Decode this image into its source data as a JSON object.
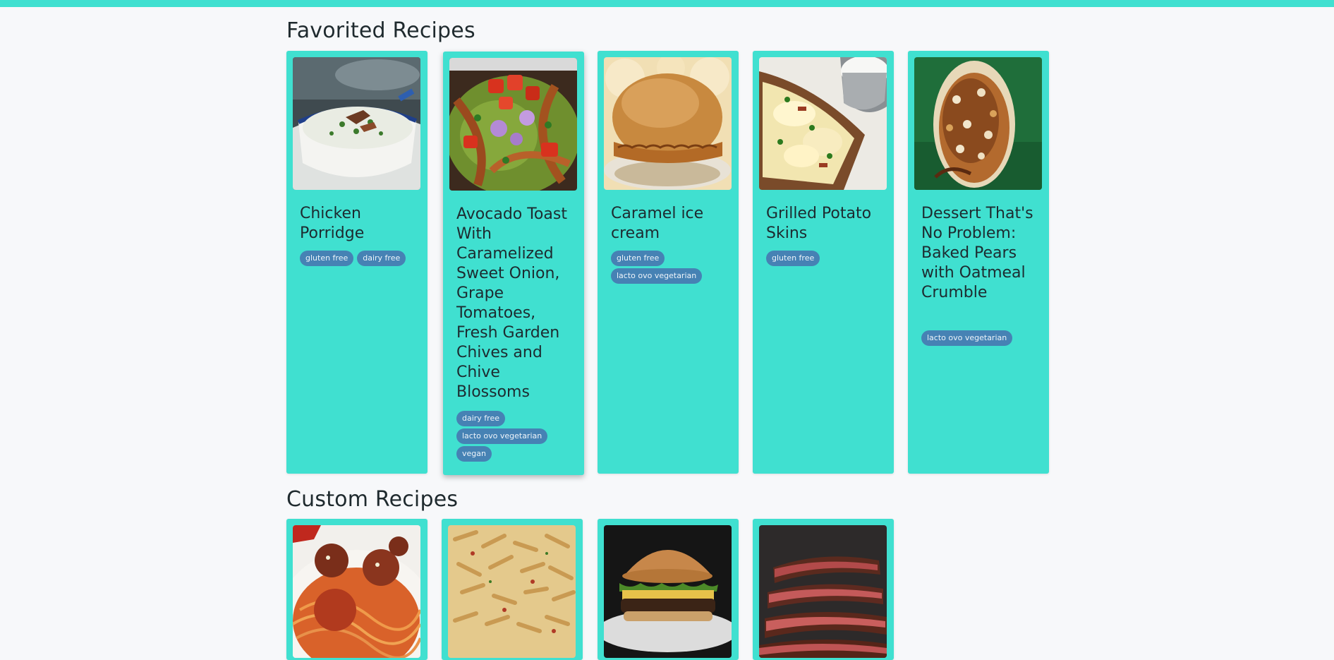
{
  "page": {
    "favorites_heading": "Favorited Recipes",
    "custom_heading": "Custom Recipes"
  },
  "colors": {
    "topbar": "#40e0d0",
    "card": "#40e0d0",
    "tag": "#4682b4",
    "background": "#f7f8fa"
  },
  "favorites": [
    {
      "title": "Chicken Porridge",
      "tags": [
        "gluten free",
        "dairy free"
      ]
    },
    {
      "title": "Avocado Toast With Caramelized Sweet Onion, Grape Tomatoes, Fresh Garden Chives and Chive Blossoms",
      "tags": [
        "dairy free",
        "lacto ovo vegetarian",
        "vegan"
      ]
    },
    {
      "title": "Caramel ice cream",
      "tags": [
        "gluten free",
        "lacto ovo vegetarian"
      ]
    },
    {
      "title": "Grilled Potato Skins",
      "tags": [
        "gluten free"
      ]
    },
    {
      "title": "Dessert That's No Problem: Baked Pears with Oatmeal Crumble",
      "tags": [
        "lacto ovo vegetarian"
      ]
    }
  ],
  "custom": [
    {
      "image": "spaghetti-meatballs-photo"
    },
    {
      "image": "penne-pasta-photo"
    },
    {
      "image": "burger-photo"
    },
    {
      "image": "steak-photo"
    }
  ]
}
